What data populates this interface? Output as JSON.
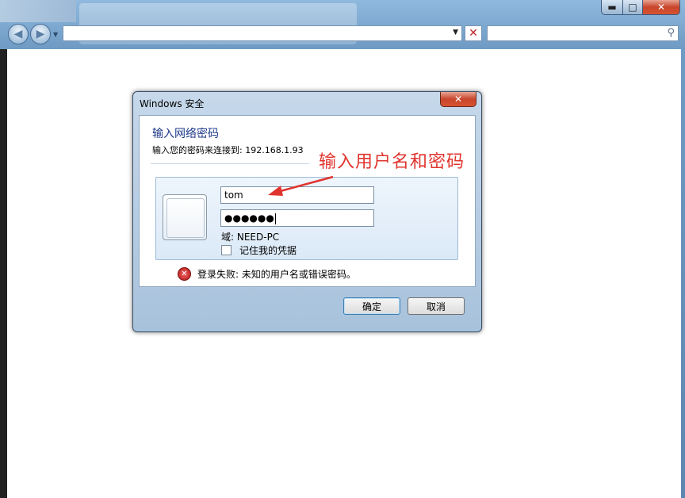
{
  "window": {
    "minimize_glyph": "▬",
    "maximize_glyph": "□",
    "close_glyph": "✕"
  },
  "navbar": {
    "back_icon": "back-arrow-icon",
    "forward_icon": "forward-arrow-icon",
    "address_value": "",
    "search_value": ""
  },
  "dialog": {
    "title": "Windows 安全",
    "heading": "输入网络密码",
    "subtitle": "输入您的密码来连接到: 192.168.1.93",
    "username_value": "tom",
    "password_value": "●●●●●●",
    "domain_label": "域: NEED-PC",
    "remember_label": "记住我的凭据",
    "error_text": "登录失败: 未知的用户名或错误密码。",
    "ok_label": "确定",
    "cancel_label": "取消"
  },
  "annotation": {
    "text": "输入用户名和密码",
    "color": "#e0342e"
  }
}
